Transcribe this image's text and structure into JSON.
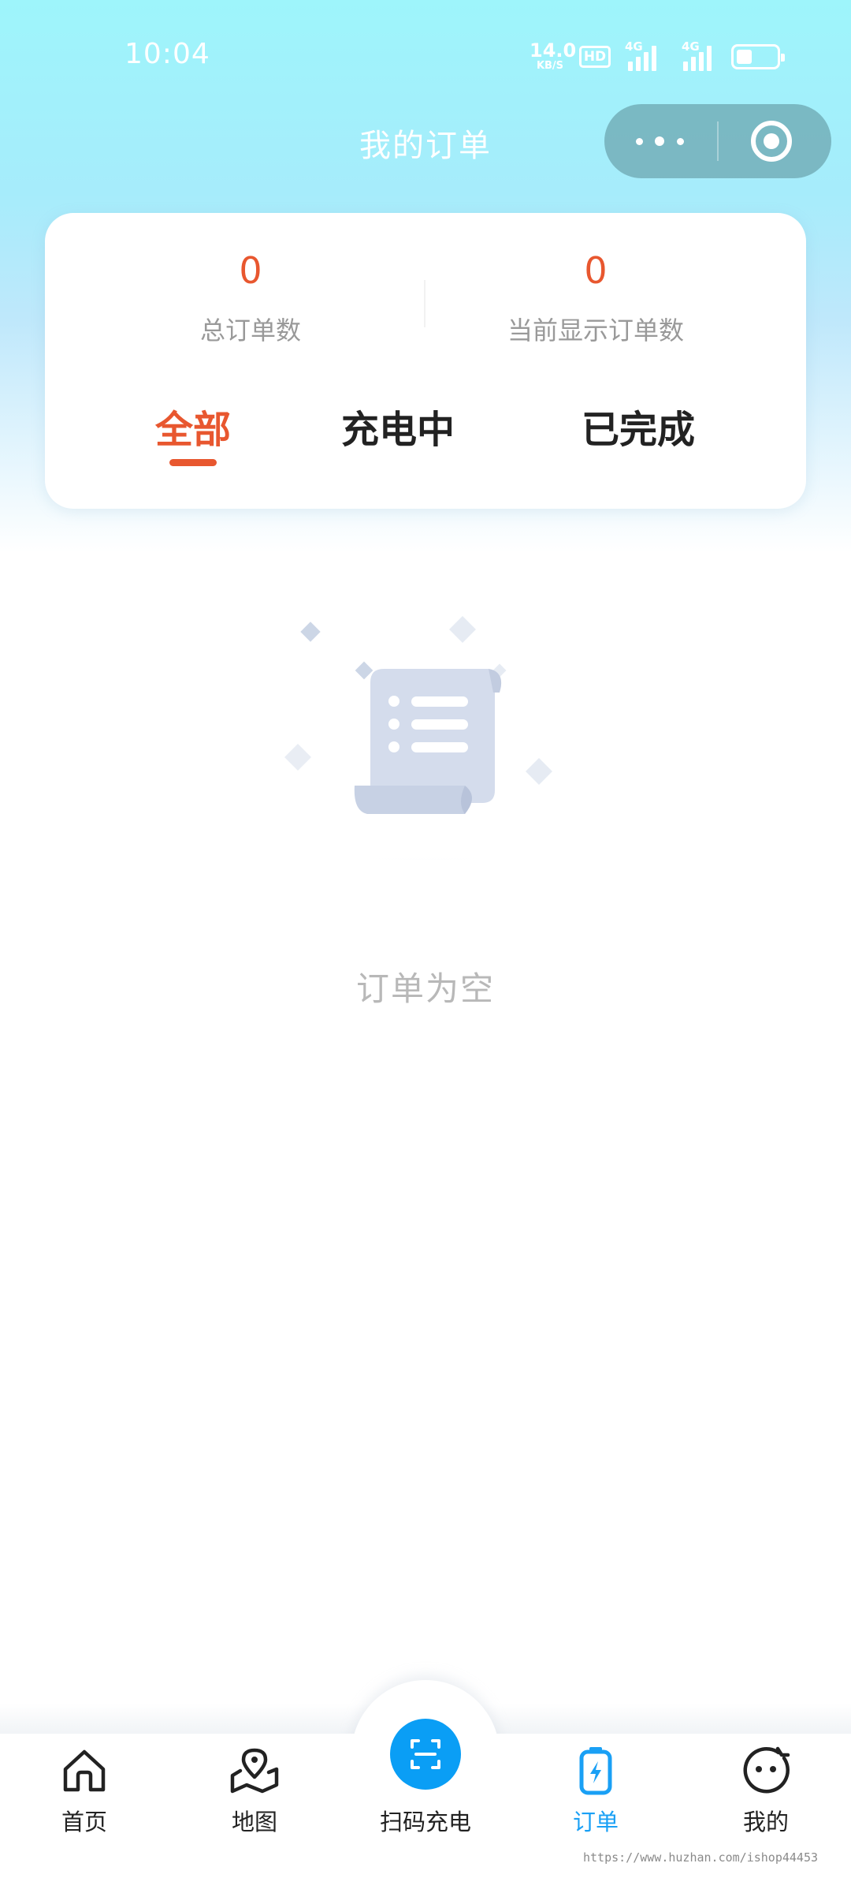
{
  "status_bar": {
    "time": "10:04",
    "net_speed": "14.0",
    "net_speed_unit": "KB/S",
    "hd_badge": "HD",
    "signal1_label": "4G",
    "signal2_label": "4G",
    "battery_level": 0.4
  },
  "header": {
    "title": "我的订单"
  },
  "stats": {
    "total_value": "0",
    "total_label": "总订单数",
    "current_value": "0",
    "current_label": "当前显示订单数"
  },
  "tabs": [
    {
      "label": "全部",
      "active": true
    },
    {
      "label": "充电中",
      "active": false
    },
    {
      "label": "已完成",
      "active": false
    }
  ],
  "empty_state": {
    "text": "订单为空"
  },
  "tabbar": {
    "items": [
      {
        "label": "首页",
        "icon": "home-icon"
      },
      {
        "label": "地图",
        "icon": "map-icon"
      },
      {
        "label": "扫码充电",
        "icon": "scan-icon"
      },
      {
        "label": "订单",
        "icon": "battery-order-icon",
        "active": true
      },
      {
        "label": "我的",
        "icon": "face-icon"
      }
    ]
  },
  "watermark": "https://www.huzhan.com/ishop44453",
  "colors": {
    "accent": "#e8572f",
    "primary_blue": "#0a9ef5",
    "active_tab_blue": "#1aa0f5",
    "header_gradient_top": "#9ef5fb"
  }
}
